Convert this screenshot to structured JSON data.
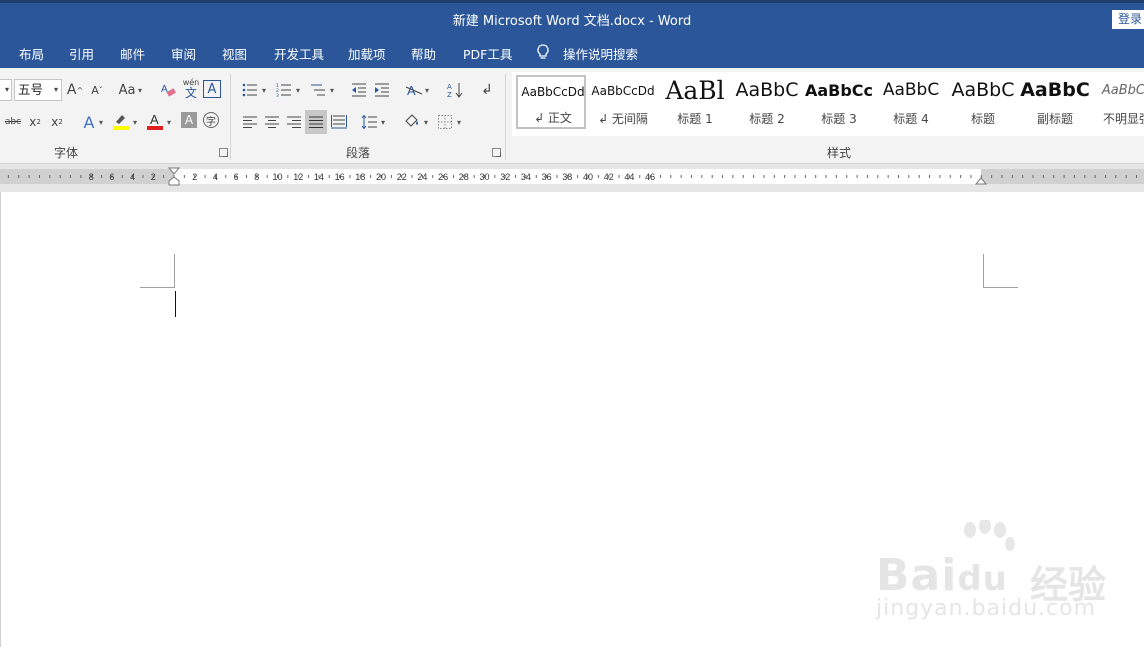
{
  "window": {
    "title": "新建 Microsoft Word 文档.docx  -  Word",
    "login_label": "登录"
  },
  "menu": {
    "tabs": [
      "布局",
      "引用",
      "邮件",
      "审阅",
      "视图",
      "开发工具",
      "加载项",
      "帮助",
      "PDF工具"
    ],
    "search_label": "操作说明搜索"
  },
  "ribbon": {
    "font_group_label": "字体",
    "paragraph_group_label": "段落",
    "styles_group_label": "样式",
    "font_size": "五号",
    "change_case_label": "Aa",
    "phonetic_label": "wén",
    "styles": [
      {
        "sample": "AaBbCcDd",
        "name": "↲ 正文",
        "selected": true
      },
      {
        "sample": "AaBbCcDd",
        "name": "↲ 无间隔",
        "selected": false
      },
      {
        "sample": "AaBl",
        "name": "标题 1",
        "selected": false
      },
      {
        "sample": "AaBbC",
        "name": "标题 2",
        "selected": false
      },
      {
        "sample": "AaBbCc",
        "name": "标题 3",
        "selected": false
      },
      {
        "sample": "AaBbC",
        "name": "标题 4",
        "selected": false
      },
      {
        "sample": "AaBbC",
        "name": "标题",
        "selected": false
      },
      {
        "sample": "AaBbC",
        "name": "副标题",
        "selected": false
      },
      {
        "sample": "AaBbCc",
        "name": "不明显强",
        "selected": false
      }
    ]
  },
  "ruler": {
    "left_numbers": [
      "8",
      "6",
      "4",
      "2"
    ],
    "right_numbers": [
      "2",
      "4",
      "6",
      "8",
      "10",
      "12",
      "14",
      "16",
      "18",
      "20",
      "22",
      "24",
      "26",
      "28",
      "30",
      "32",
      "34",
      "36",
      "38",
      "40",
      "42",
      "44",
      "46"
    ]
  },
  "watermark": {
    "brand": "Bai",
    "brand2": "du",
    "brand_cn": "经验",
    "url": "jingyan.baidu.com"
  },
  "colors": {
    "title_bar": "#2b579a",
    "ribbon_bg": "#f3f3f3",
    "font_color_red": "#e02020",
    "highlight_yellow": "#ffff00"
  }
}
